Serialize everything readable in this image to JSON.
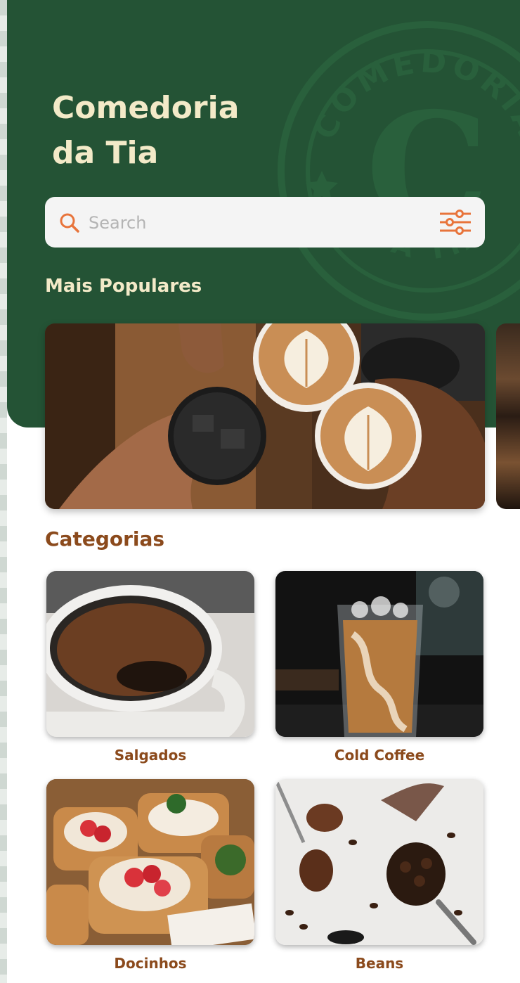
{
  "header": {
    "title": "Comedoria\nda Tia",
    "logo_text_top": "COMEDORIA",
    "logo_text_bottom": "DA TIA",
    "logo_letter": "C"
  },
  "search": {
    "placeholder": "Search",
    "value": "",
    "icon": "search-icon",
    "filter_icon": "sliders-icon"
  },
  "popular": {
    "label": "Mais Populares",
    "items": [
      {
        "image": "coffee-cheers-photo"
      },
      {
        "image": "coffee-photo-partial"
      }
    ]
  },
  "categories": {
    "label": "Categorias",
    "items": [
      {
        "label": "Salgados",
        "image": "hot-coffee-mug-photo"
      },
      {
        "label": "Cold Coffee",
        "image": "iced-coffee-glass-photo"
      },
      {
        "label": "Docinhos",
        "image": "strawberry-danish-photo"
      },
      {
        "label": "Beans",
        "image": "coffee-beans-photo"
      }
    ]
  },
  "colors": {
    "header_bg": "#245335",
    "title": "#F3EAC8",
    "accent": "#E8743B",
    "category_text": "#8B4A1C"
  }
}
